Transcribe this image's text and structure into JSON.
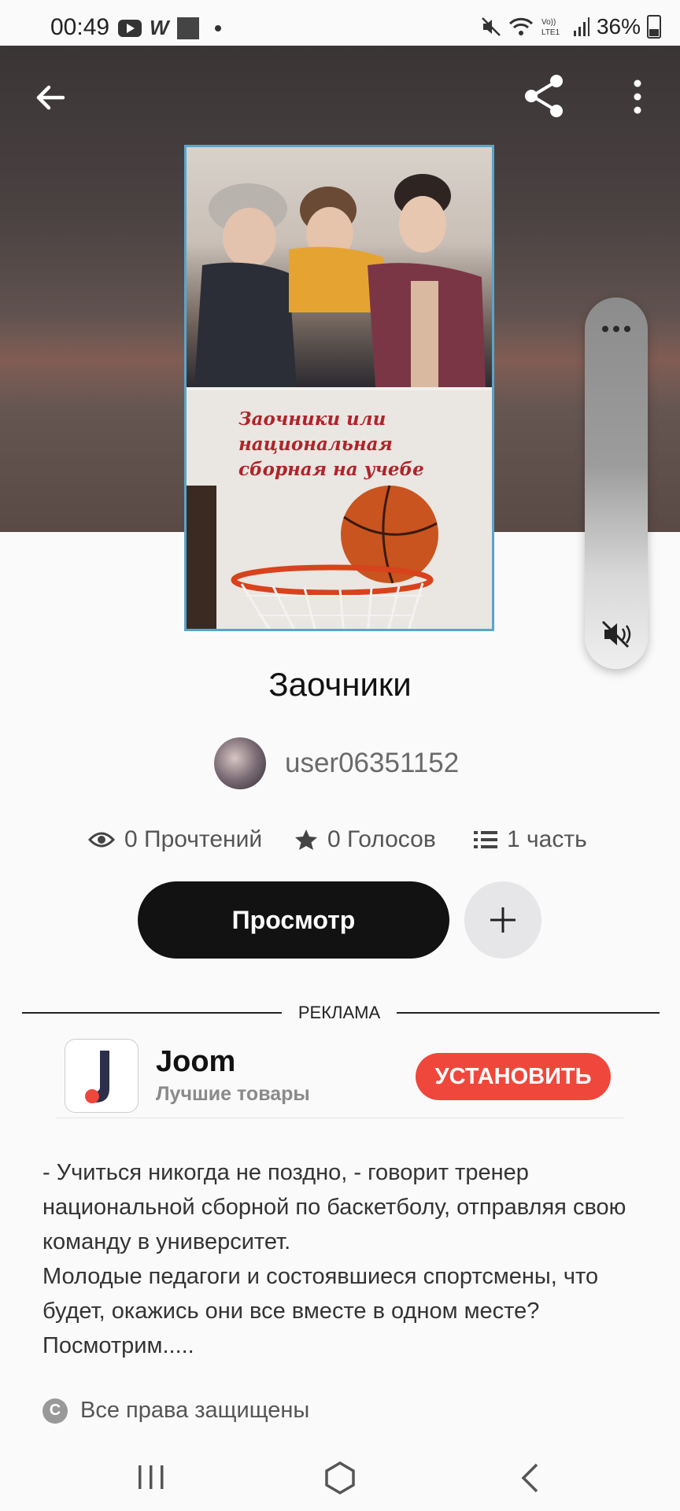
{
  "status_bar": {
    "time": "00:49",
    "battery": "36%"
  },
  "header": {
    "back_icon": "arrow-left-icon",
    "share_icon": "share-icon",
    "more_icon": "more-vertical-icon"
  },
  "cover": {
    "title_text": "Заочники или национальная сборная на учебе"
  },
  "book": {
    "title": "Заочники",
    "author": "user06351152"
  },
  "stats": {
    "reads": "0 Прочтений",
    "votes": "0 Голосов",
    "parts": "1 часть"
  },
  "actions": {
    "view_label": "Просмотр",
    "add_icon": "plus-icon"
  },
  "ad": {
    "label": "РЕКЛАМА",
    "app_name": "Joom",
    "tagline": "Лучшие товары",
    "install_label": "УСТАНОВИТЬ"
  },
  "description": {
    "paragraph_1": "- Учиться никогда не поздно, - говорит тренер национальной сборной по баскетболу, отправляя свою команду в университет.",
    "paragraph_2": "Молодые педагоги и состоявшиеся спортсмены, что будет, окажись они все вместе в одном месте? Посмотрим....."
  },
  "copyright": {
    "icon_letter": "C",
    "text": "Все права защищены"
  },
  "colors": {
    "accent_install": "#f0473c",
    "cover_border": "#5aa5c9",
    "view_button": "#121212"
  }
}
